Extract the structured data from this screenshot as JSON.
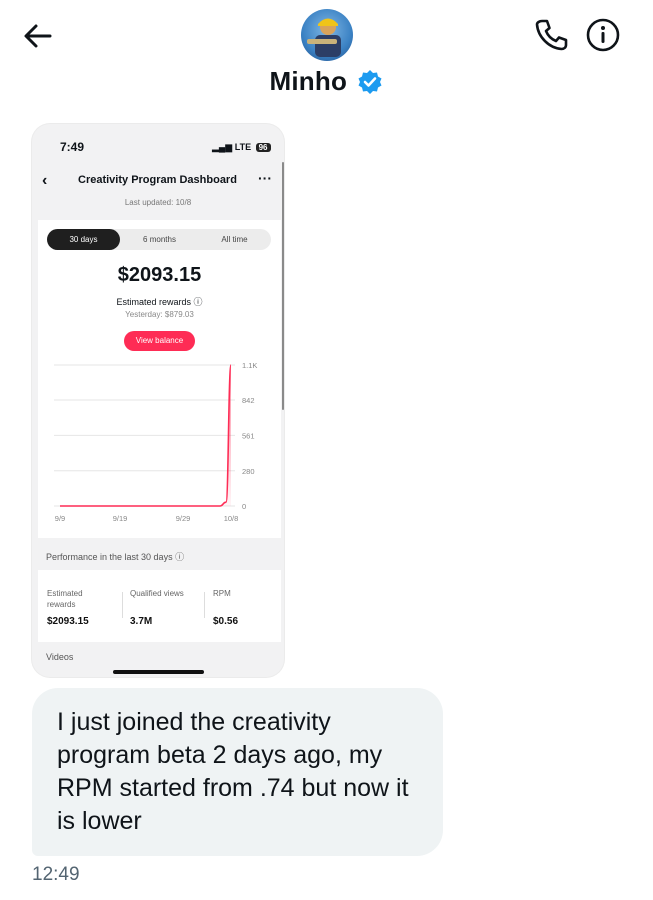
{
  "header": {
    "back_icon": "arrow-left-icon",
    "contact_name": "Minho",
    "verified": true,
    "call_icon": "phone-icon",
    "info_icon": "info-icon",
    "brand_color": "#1d9bf0"
  },
  "attachment": {
    "status_time": "7:49",
    "network": "LTE",
    "battery": "96",
    "title": "Creativity Program Dashboard",
    "last_updated": "Last updated: 10/8",
    "tabs": [
      {
        "label": "30 days",
        "active": true
      },
      {
        "label": "6 months",
        "active": false
      },
      {
        "label": "All time",
        "active": false
      }
    ],
    "amount": "$2093.15",
    "estimated_rewards_label": "Estimated rewards ⓘ",
    "yesterday": "Yesterday: $879.03",
    "view_balance": "View balance",
    "accent_color": "#fe2c55",
    "chart_data": {
      "type": "area",
      "x_tick_labels": [
        "9/9",
        "9/19",
        "9/29",
        "10/8"
      ],
      "y_tick_labels": [
        "1.1K",
        "842",
        "561",
        "280",
        "0"
      ],
      "ylim": [
        0,
        1120
      ],
      "series": [
        {
          "x": [
            "9/9",
            "9/19",
            "9/29",
            "10/6",
            "10/7",
            "10/8"
          ],
          "values": [
            0,
            0,
            0,
            0,
            30,
            1120
          ]
        }
      ],
      "grid": true
    },
    "performance_title": "Performance in the last 30 days ⓘ",
    "metrics": [
      {
        "label": "Estimated rewards",
        "value": "$2093.15"
      },
      {
        "label": "Qualified views",
        "value": "3.7M"
      },
      {
        "label": "RPM",
        "value": "$0.56"
      }
    ],
    "videos_label": "Videos"
  },
  "message": {
    "text": "I just joined the creativity program beta 2 days ago, my RPM started from .74 but now it is lower",
    "timestamp": "12:49"
  }
}
